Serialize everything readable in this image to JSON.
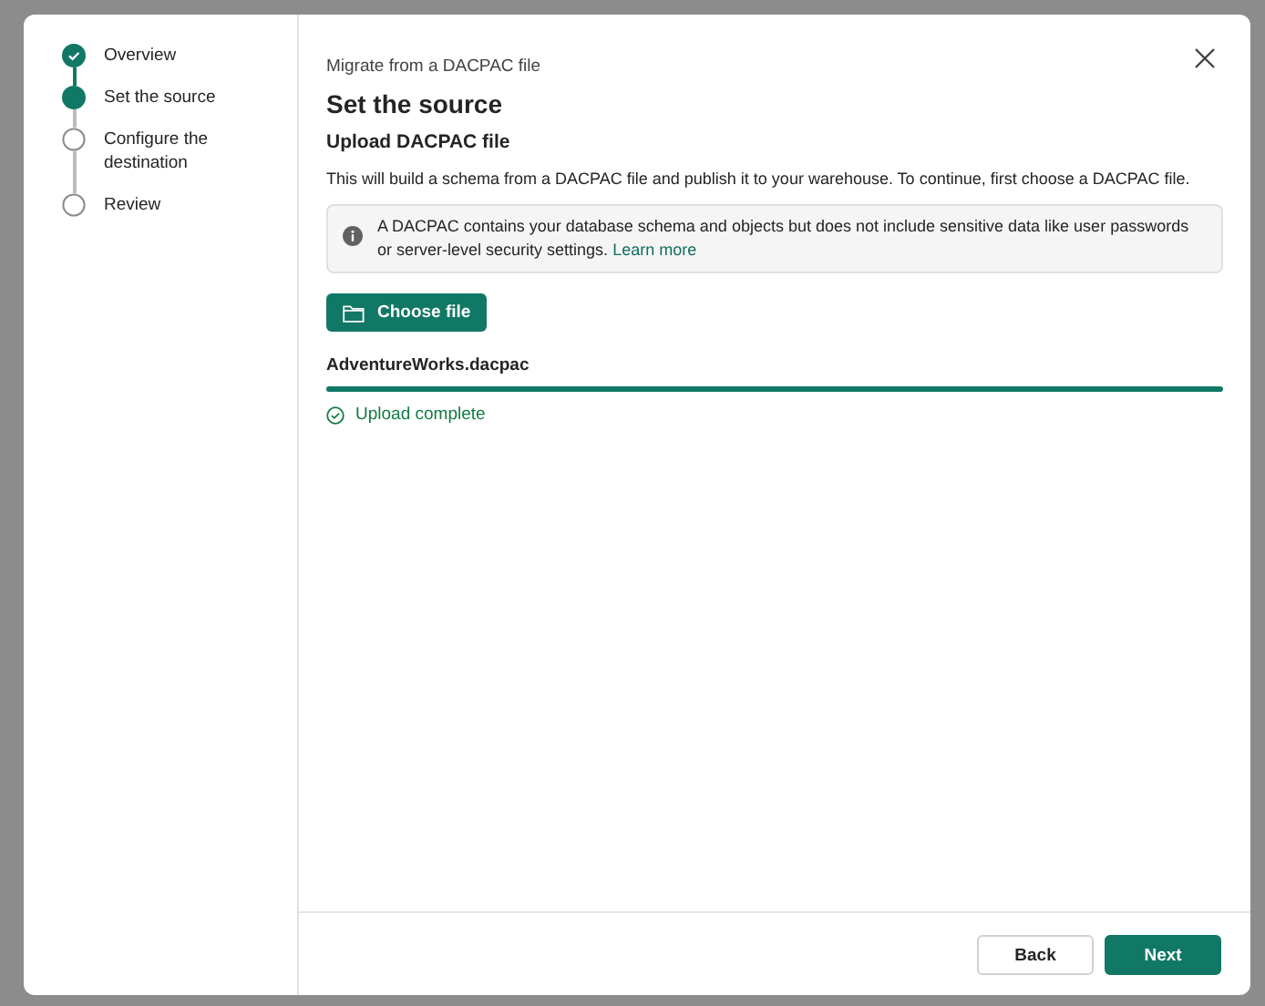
{
  "steps": [
    {
      "label": "Overview",
      "kind": "done"
    },
    {
      "label": "Set the source",
      "kind": "current"
    },
    {
      "label": "Configure the destination",
      "kind": "pending"
    },
    {
      "label": "Review",
      "kind": "pending"
    }
  ],
  "dialog": {
    "subtitle": "Migrate from a DACPAC file",
    "title": "Set the source"
  },
  "section": {
    "heading": "Upload DACPAC file",
    "description": "This will build a schema from a DACPAC file and publish it to your warehouse. To continue, first choose a DACPAC file."
  },
  "info": {
    "text": "A DACPAC contains your database schema and objects but does not include sensitive data like user passwords or server-level security settings.",
    "link": "Learn more"
  },
  "choose_button": "Choose file",
  "upload": {
    "file_name": "AdventureWorks.dacpac",
    "level": 1,
    "status": "Upload complete"
  },
  "buttons": {
    "back": "Back",
    "next": "Next"
  }
}
